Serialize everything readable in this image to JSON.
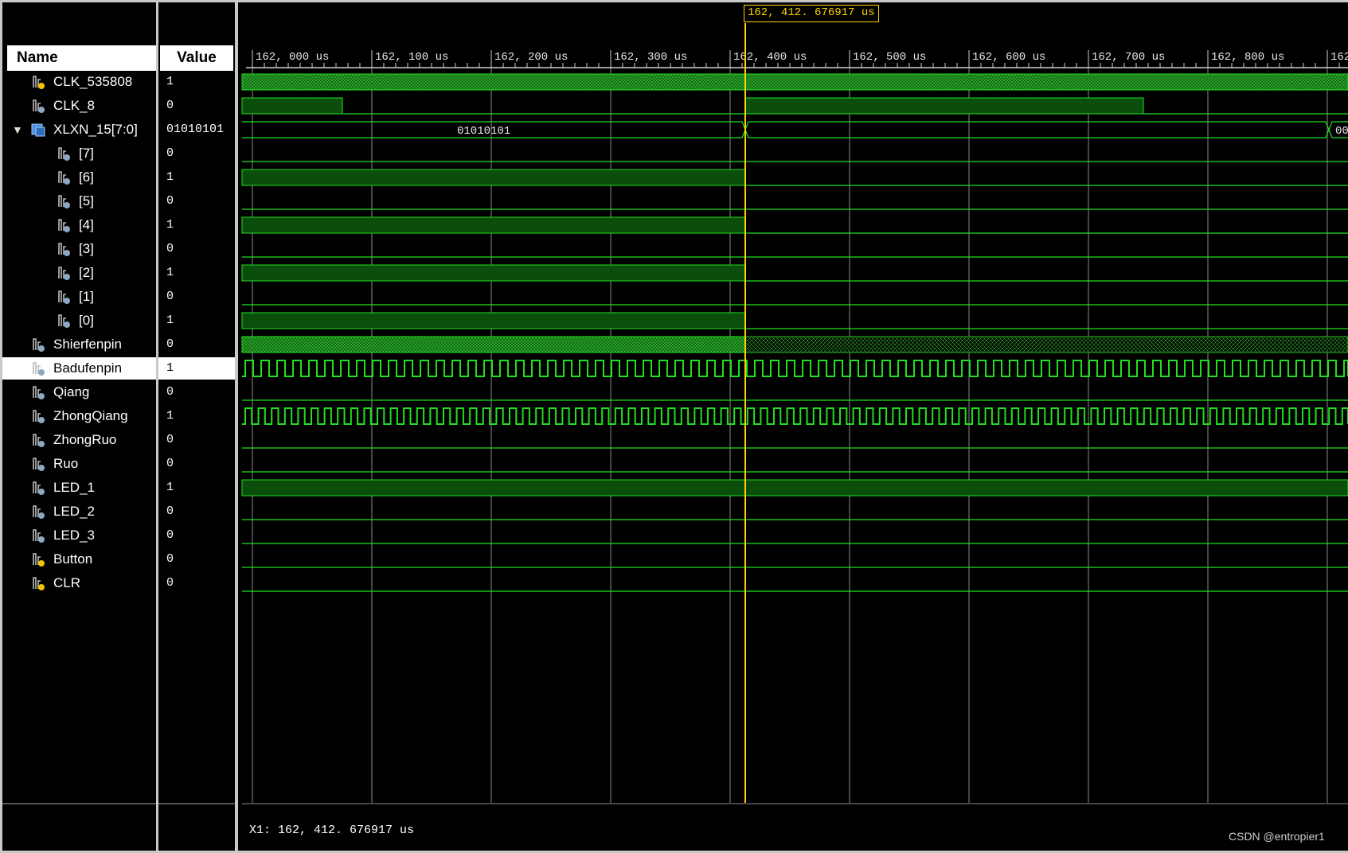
{
  "header": {
    "name_label": "Name",
    "value_label": "Value"
  },
  "signals": [
    {
      "name": "CLK_535808",
      "value": "1",
      "indent": 0,
      "icon": "input-signal-icon",
      "wave": "dense-clock"
    },
    {
      "name": "CLK_8",
      "value": "0",
      "indent": 0,
      "icon": "signal-icon",
      "wave": "clk8"
    },
    {
      "name": "XLXN_15[7:0]",
      "value": "01010101",
      "indent": 0,
      "icon": "bus-icon",
      "wave": "bus",
      "expanded": true
    },
    {
      "name": "[7]",
      "value": "0",
      "indent": 1,
      "icon": "signal-icon",
      "wave": "low"
    },
    {
      "name": "[6]",
      "value": "1",
      "indent": 1,
      "icon": "signal-icon",
      "wave": "high-until-cursor"
    },
    {
      "name": "[5]",
      "value": "0",
      "indent": 1,
      "icon": "signal-icon",
      "wave": "low"
    },
    {
      "name": "[4]",
      "value": "1",
      "indent": 1,
      "icon": "signal-icon",
      "wave": "high-until-cursor"
    },
    {
      "name": "[3]",
      "value": "0",
      "indent": 1,
      "icon": "signal-icon",
      "wave": "low"
    },
    {
      "name": "[2]",
      "value": "1",
      "indent": 1,
      "icon": "signal-icon",
      "wave": "high-until-cursor"
    },
    {
      "name": "[1]",
      "value": "0",
      "indent": 1,
      "icon": "signal-icon",
      "wave": "low"
    },
    {
      "name": "[0]",
      "value": "1",
      "indent": 1,
      "icon": "signal-icon",
      "wave": "high-until-cursor"
    },
    {
      "name": "Shierfenpin",
      "value": "0",
      "indent": 0,
      "icon": "signal-icon",
      "wave": "dense-then-sparse"
    },
    {
      "name": "Badufenpin",
      "value": "1",
      "indent": 0,
      "icon": "signal-icon",
      "wave": "pulse-medium",
      "selected": true
    },
    {
      "name": "Qiang",
      "value": "0",
      "indent": 0,
      "icon": "signal-icon",
      "wave": "low"
    },
    {
      "name": "ZhongQiang",
      "value": "1",
      "indent": 0,
      "icon": "signal-icon",
      "wave": "pulse-narrow"
    },
    {
      "name": "ZhongRuo",
      "value": "0",
      "indent": 0,
      "icon": "signal-icon",
      "wave": "low"
    },
    {
      "name": "Ruo",
      "value": "0",
      "indent": 0,
      "icon": "signal-icon",
      "wave": "low"
    },
    {
      "name": "LED_1",
      "value": "1",
      "indent": 0,
      "icon": "signal-icon",
      "wave": "high"
    },
    {
      "name": "LED_2",
      "value": "0",
      "indent": 0,
      "icon": "signal-icon",
      "wave": "low"
    },
    {
      "name": "LED_3",
      "value": "0",
      "indent": 0,
      "icon": "signal-icon",
      "wave": "low"
    },
    {
      "name": "Button",
      "value": "0",
      "indent": 0,
      "icon": "input-signal-icon",
      "wave": "low"
    },
    {
      "name": "CLR",
      "value": "0",
      "indent": 0,
      "icon": "input-signal-icon",
      "wave": "low"
    }
  ],
  "bus_labels": {
    "before": "01010101",
    "after": "00"
  },
  "timeline": {
    "ticks": [
      "162, 000 us",
      "162, 100 us",
      "162, 200 us",
      "162, 300 us",
      "162, 400 us",
      "162, 500 us",
      "162, 600 us",
      "162, 700 us",
      "162, 800 us",
      "162"
    ],
    "cursor_label": "162, 412. 676917 us"
  },
  "status": {
    "cursor_readout": "X1:  162, 412. 676917 us"
  },
  "watermark": "CSDN @entropier1",
  "colors": {
    "wave": "#21e021",
    "wave_fill": "#0b4d0b",
    "cursor": "#ffd400",
    "grid": "#8a8a8a"
  }
}
